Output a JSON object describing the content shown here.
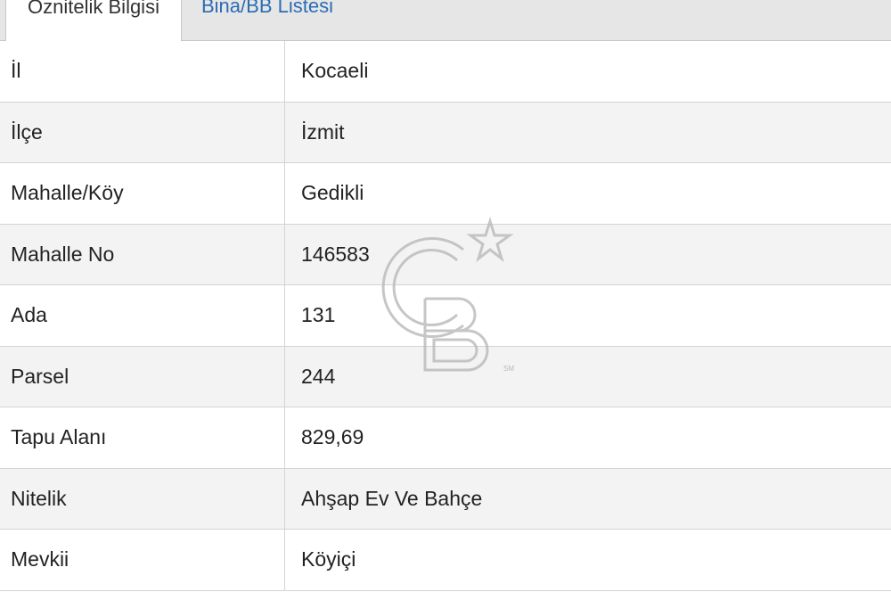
{
  "tabs": [
    {
      "label": "Öznitelik Bilgisi",
      "active": true
    },
    {
      "label": "Bina/BB Listesi",
      "active": false
    }
  ],
  "rows": [
    {
      "key": "İl",
      "value": "Kocaeli"
    },
    {
      "key": "İlçe",
      "value": "İzmit"
    },
    {
      "key": "Mahalle/Köy",
      "value": "Gedikli"
    },
    {
      "key": "Mahalle No",
      "value": "146583"
    },
    {
      "key": "Ada",
      "value": "131"
    },
    {
      "key": "Parsel",
      "value": "244"
    },
    {
      "key": "Tapu Alanı",
      "value": "829,69"
    },
    {
      "key": "Nitelik",
      "value": "Ahşap Ev Ve Bahçe"
    },
    {
      "key": "Mevkii",
      "value": "Köyiçi"
    }
  ],
  "watermark": {
    "text": "CB",
    "mark": "SM"
  },
  "colors": {
    "tab_bar_bg": "#e6e6e6",
    "link_blue": "#2a6db5",
    "row_alt_bg": "#f3f3f3",
    "border": "#d4d4d4"
  }
}
